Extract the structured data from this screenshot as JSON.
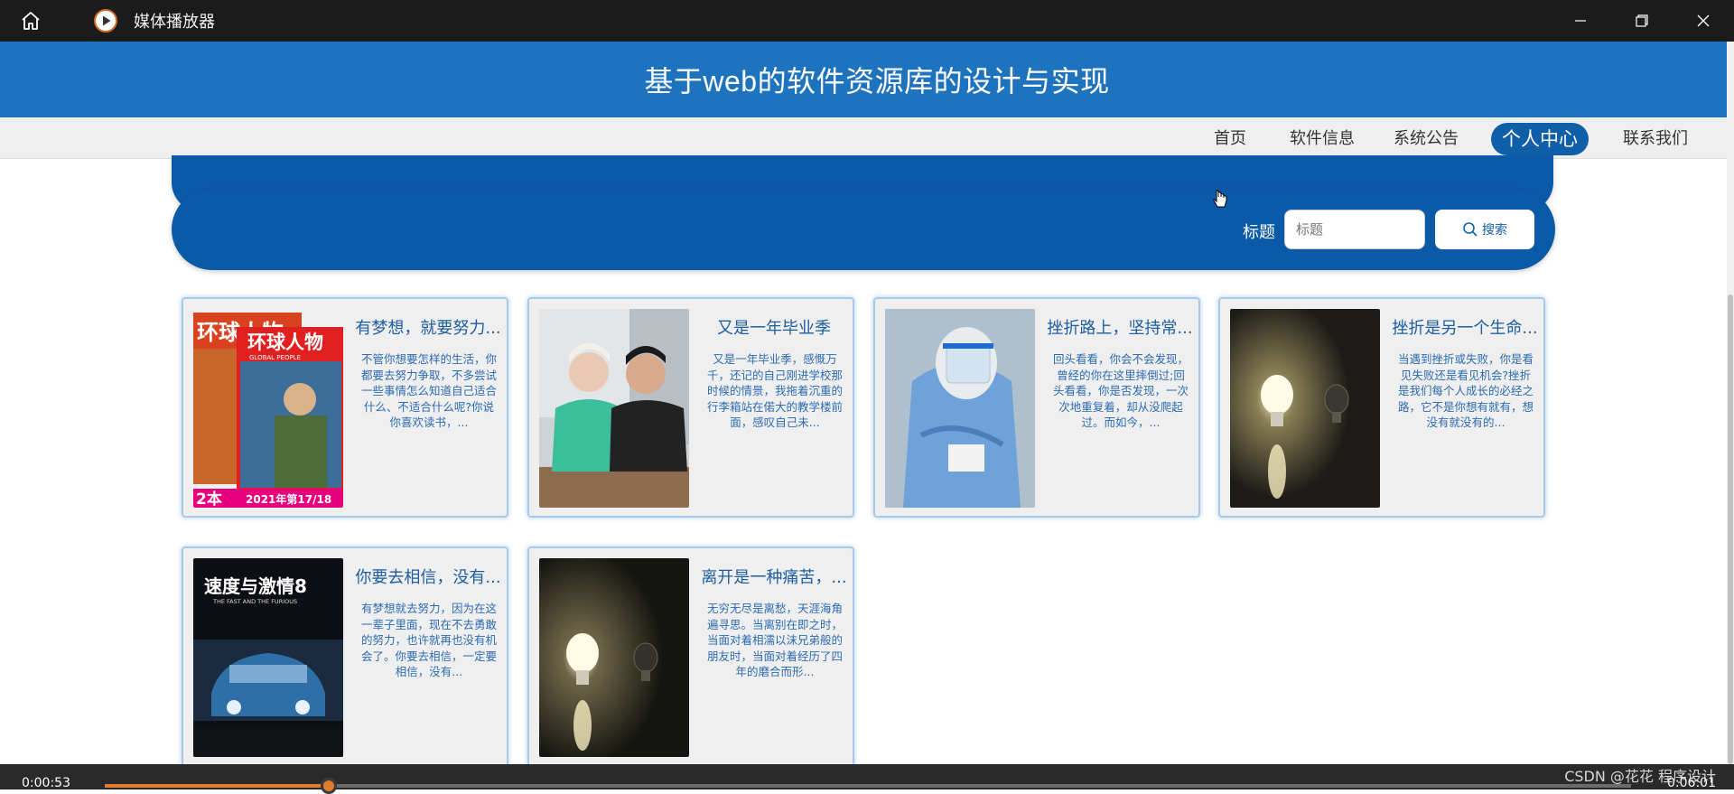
{
  "player": {
    "title": "媒体播放器",
    "time_current": "0:00:53",
    "time_total": "0:06:01",
    "progress": 0.147,
    "watermark": "CSDN @花花 程序设计",
    "accent": "#e07a2c"
  },
  "site": {
    "title": "基于web的软件资源库的设计与实现",
    "header_color": "#1e73be",
    "band_color": "#0b5aa8"
  },
  "nav": {
    "items": [
      "首页",
      "软件信息",
      "系统公告",
      "个人中心",
      "联系我们"
    ],
    "active": "个人中心"
  },
  "search": {
    "label": "标题",
    "placeholder": "标题",
    "button_label": "搜索"
  },
  "cards": [
    {
      "title": "有梦想，就要努力...",
      "desc": "不管你想要怎样的生活，你都要去努力争取，不多尝试一些事情怎么知道自己适合什么、不适合什么呢?你说你喜欢读书，..."
    },
    {
      "title": "又是一年毕业季",
      "desc": "又是一年毕业季，感慨万千，还记的自己刚进学校那时候的情景，我拖着沉重的行李箱站在偌大的教学楼前面，感叹自己未..."
    },
    {
      "title": "挫折路上，坚持常...",
      "desc": "回头看看，你会不会发现，曾经的你在这里摔倒过;回头看看，你是否发现，一次次地重复着，却从没爬起过。而如今，..."
    },
    {
      "title": "挫折是另一个生命...",
      "desc": "当遇到挫折或失败，你是看见失败还是看见机会?挫折是我们每个人成长的必经之路，它不是你想有就有，想没有就没有的..."
    },
    {
      "title": "你要去相信，没有...",
      "desc": "有梦想就去努力，因为在这一辈子里面，现在不去勇敢的努力，也许就再也没有机会了。你要去相信，一定要相信，没有..."
    },
    {
      "title": "离开是一种痛苦，...",
      "desc": "无穷无尽是离愁，天涯海角遍寻思。当离别在即之时，当面对着相濡以沫兄弟般的朋友时，当面对着经历了四年的磨合而形..."
    }
  ],
  "images": {
    "magazine_cover_title": "环球人物",
    "magazine_cover_subtitle": "GLOBAL PEOPLE",
    "magazine_badge": "2本",
    "magazine_issue": "2021年第17/18",
    "movie_poster_title": "速度与激情8",
    "movie_poster_subtitle": "THE FAST AND THE FURIOUS"
  }
}
